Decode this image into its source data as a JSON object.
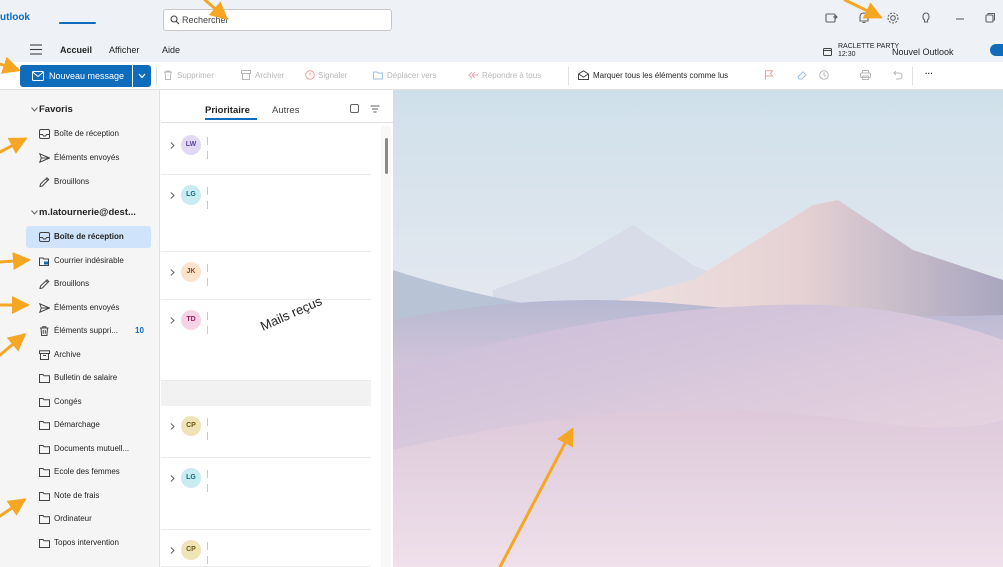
{
  "app": {
    "brand": "utlook"
  },
  "search": {
    "placeholder": "Rechercher"
  },
  "menu": {
    "items": [
      "Accueil",
      "Afficher",
      "Aide"
    ]
  },
  "event": {
    "title": "RACLETTE PARTY",
    "time": "12:30"
  },
  "new_outlook": {
    "label": "Nouvel Outlook",
    "enabled": true
  },
  "toolbar": {
    "new_message": "Nouveau message",
    "delete": "Supprimer",
    "archive": "Archiver",
    "report": "Signaler",
    "move": "Déplacer vers",
    "reply_all": "Répondre à tous",
    "mark_all_read": "Marquer tous les éléments comme lus",
    "more": "···"
  },
  "sidebar": {
    "favorites_title": "Favoris",
    "favorites": [
      {
        "label": "Boîte de réception",
        "icon": "inbox-icon"
      },
      {
        "label": "Éléments envoyés",
        "icon": "send-icon"
      },
      {
        "label": "Brouillons",
        "icon": "pencil-icon"
      }
    ],
    "account_title": "m.latournerie@dest...",
    "folders": [
      {
        "label": "Boîte de réception",
        "icon": "inbox-icon",
        "selected": true
      },
      {
        "label": "Courrier indésirable",
        "icon": "junk-icon"
      },
      {
        "label": "Brouillons",
        "icon": "pencil-icon"
      },
      {
        "label": "Éléments envoyés",
        "icon": "send-icon"
      },
      {
        "label": "Éléments suppri...",
        "icon": "trash-icon",
        "count": "10"
      },
      {
        "label": "Archive",
        "icon": "archive-icon"
      },
      {
        "label": "Bulletin de salaire",
        "icon": "folder-icon"
      },
      {
        "label": "Congés",
        "icon": "folder-icon"
      },
      {
        "label": "Démarchage",
        "icon": "folder-icon"
      },
      {
        "label": "Documents mutuell...",
        "icon": "folder-icon"
      },
      {
        "label": "Ecole des femmes",
        "icon": "folder-icon"
      },
      {
        "label": "Note de frais",
        "icon": "folder-icon"
      },
      {
        "label": "Ordinateur",
        "icon": "folder-icon"
      },
      {
        "label": "Topos intervention",
        "icon": "folder-icon"
      }
    ]
  },
  "list": {
    "tabs": [
      "Prioritaire",
      "Autres"
    ],
    "annotation": "Mails reçus",
    "rows": [
      {
        "initials": "LW",
        "bg": "#e2d9f5",
        "fg": "#5b3fa3"
      },
      {
        "initials": "LG",
        "bg": "#c8ecf0",
        "fg": "#0f6d7a"
      },
      {
        "initials": "JK",
        "bg": "#fbe3cc",
        "fg": "#8a4a12"
      },
      {
        "initials": "TD",
        "bg": "#f6d3e5",
        "fg": "#9a1f5e"
      },
      {
        "initials": "CP",
        "bg": "#efe4b8",
        "fg": "#6b5a10"
      },
      {
        "initials": "LG",
        "bg": "#c8ecf0",
        "fg": "#0f6d7a"
      },
      {
        "initials": "CP",
        "bg": "#efe4b8",
        "fg": "#6b5a10"
      }
    ]
  },
  "colors": {
    "accent": "#0f6cbd",
    "arrow": "#f5a623"
  }
}
